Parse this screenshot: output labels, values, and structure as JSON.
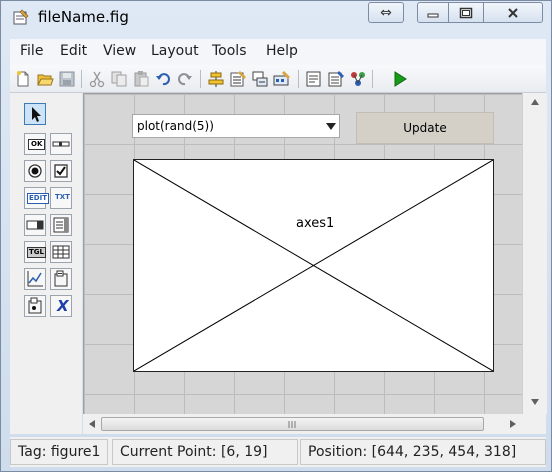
{
  "window": {
    "title": "fileName.fig"
  },
  "caption_buttons": [
    {
      "name": "restore-arrows",
      "glyph": "⇔"
    },
    {
      "name": "minimize",
      "glyph": "▁"
    },
    {
      "name": "maximize",
      "glyph": "▢"
    },
    {
      "name": "close",
      "glyph": "✕"
    }
  ],
  "menu": {
    "items": [
      "File",
      "Edit",
      "View",
      "Layout",
      "Tools",
      "Help"
    ]
  },
  "toolbar": {
    "icons": [
      "new-file-icon",
      "open-file-icon",
      "save-icon",
      "cut-icon",
      "copy-icon",
      "paste-icon",
      "undo-icon",
      "redo-icon",
      "align-icon",
      "menu-editor-icon",
      "tab-order-icon",
      "toolbar-editor-icon",
      "m-file-editor-icon",
      "property-inspector-icon",
      "object-browser-icon",
      "run-icon"
    ]
  },
  "palette": {
    "tools": [
      {
        "name": "select-tool",
        "label": ""
      },
      {
        "name": "push-button-tool",
        "label": "OK"
      },
      {
        "name": "slider-tool",
        "label": ""
      },
      {
        "name": "radio-button-tool",
        "label": ""
      },
      {
        "name": "checkbox-tool",
        "label": ""
      },
      {
        "name": "edit-text-tool",
        "label": "EDIT"
      },
      {
        "name": "static-text-tool",
        "label": "TXT"
      },
      {
        "name": "popup-menu-tool",
        "label": ""
      },
      {
        "name": "listbox-tool",
        "label": ""
      },
      {
        "name": "toggle-button-tool",
        "label": "TGL"
      },
      {
        "name": "table-tool",
        "label": ""
      },
      {
        "name": "axes-tool",
        "label": ""
      },
      {
        "name": "panel-tool",
        "label": ""
      },
      {
        "name": "button-group-tool",
        "label": ""
      },
      {
        "name": "activex-tool",
        "label": "X"
      }
    ]
  },
  "canvas": {
    "popup_value": "plot(rand(5))",
    "update_label": "Update",
    "axes_label": "axes1"
  },
  "status": {
    "tag": "Tag: figure1",
    "current_point": "Current Point:  [6, 19]",
    "position": "Position: [644, 235, 454, 318]"
  },
  "colors": {
    "canvas_bg": "#d6d6d6",
    "grid": "#bcbcbc",
    "button_bg": "#d4d0c8",
    "run_green": "#1a9a1a"
  }
}
